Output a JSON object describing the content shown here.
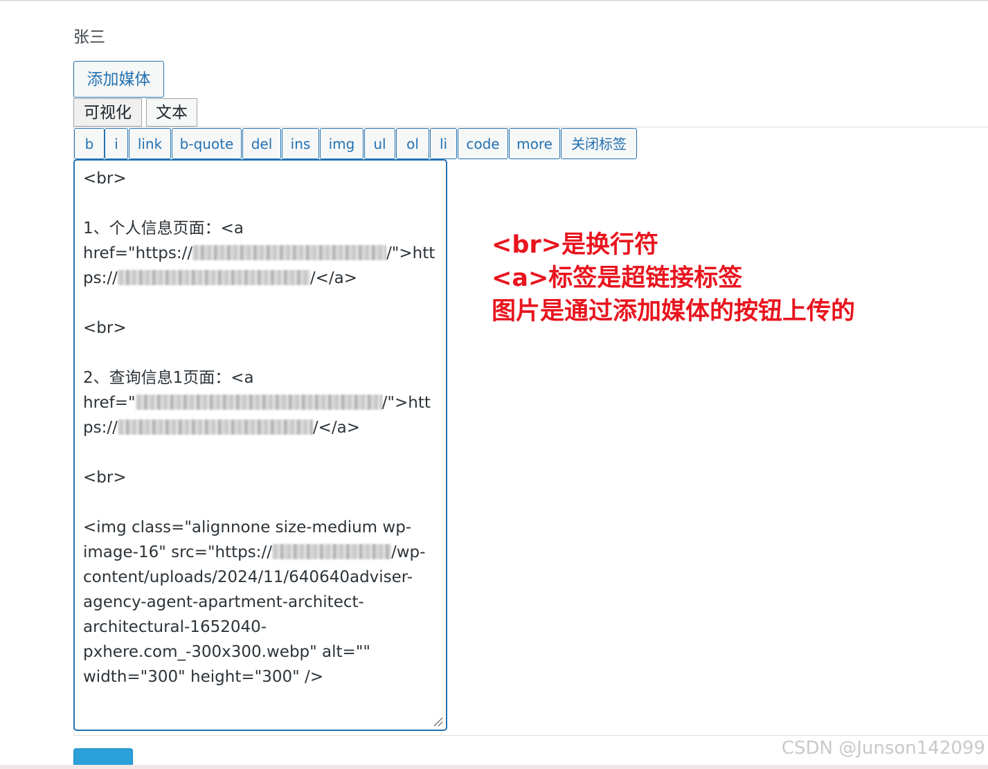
{
  "author": {
    "name": "张三"
  },
  "toolbar": {
    "add_media_label": "添加媒体",
    "tab_visual_label": "可视化",
    "tab_text_label": "文本"
  },
  "quicktags": [
    {
      "label": "b"
    },
    {
      "label": "i"
    },
    {
      "label": "link"
    },
    {
      "label": "b-quote"
    },
    {
      "label": "del"
    },
    {
      "label": "ins"
    },
    {
      "label": "img"
    },
    {
      "label": "ul"
    },
    {
      "label": "ol"
    },
    {
      "label": "li"
    },
    {
      "label": "code"
    },
    {
      "label": "more"
    },
    {
      "label": "关闭标签"
    }
  ],
  "editor": {
    "lines": [
      "<br>",
      "",
      "1、个人信息页面：<a",
      "href=\"https://",
      "/\">htt",
      "ps://",
      "/</a>",
      "<br>",
      "2、查询信息1页面：<a",
      "href=\"",
      "/\">htt",
      "ps://",
      "/</a>",
      "<br>",
      "<img class=\"alignnone size-medium wp-",
      "image-16\" src=\"https://",
      "/wp-",
      "content/uploads/2024/11/640640adviser-",
      "agency-agent-apartment-architect-",
      "architectural-1652040-",
      "pxhere.com_-300x300.webp\" alt=\"\"",
      "width=\"300\" height=\"300\" />"
    ]
  },
  "annotation": {
    "line1": "<br>是换行符",
    "line2": "<a>标签是超链接标签",
    "line3": "图片是通过添加媒体的按钮上传的",
    "color": "#e8141e"
  },
  "watermark": {
    "text": "CSDN @Junson142099"
  },
  "colors": {
    "accent": "#2271b1",
    "publish": "#2a9fd8"
  },
  "icons": {
    "resize": "resize-handle-icon"
  }
}
